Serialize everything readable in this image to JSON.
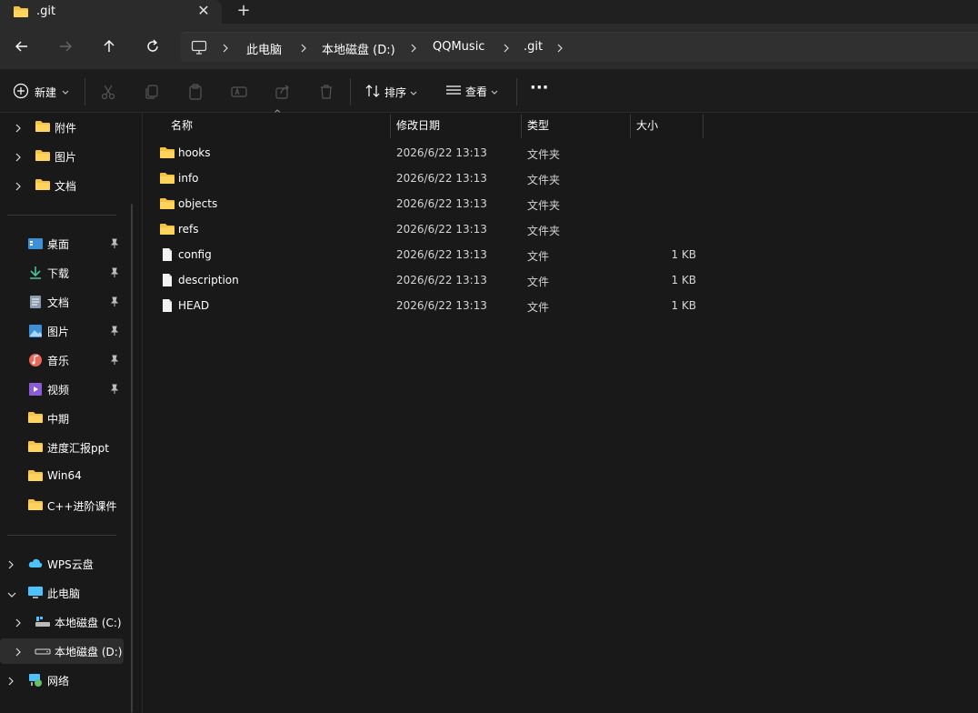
{
  "tab": {
    "title": ".git",
    "close": "✕",
    "new": "+"
  },
  "nav": {
    "back": "back-arrow-icon",
    "forward": "forward-arrow-icon",
    "up": "up-arrow-icon",
    "refresh": "refresh-icon"
  },
  "breadcrumb": [
    "此电脑",
    "本地磁盘 (D:)",
    "QQMusic",
    ".git"
  ],
  "toolbar": {
    "new_label": "新建",
    "sort_label": "排序",
    "view_label": "查看",
    "more_label": "···"
  },
  "sidebar": {
    "top_items": [
      "附件",
      "图片",
      "文档"
    ],
    "quick_access": [
      {
        "label": "桌面",
        "icon": "desktop-icon",
        "pinned": true
      },
      {
        "label": "下载",
        "icon": "download-icon",
        "pinned": true
      },
      {
        "label": "文档",
        "icon": "document-icon",
        "pinned": true
      },
      {
        "label": "图片",
        "icon": "picture-icon",
        "pinned": true
      },
      {
        "label": "音乐",
        "icon": "music-icon",
        "pinned": true
      },
      {
        "label": "视频",
        "icon": "video-icon",
        "pinned": true
      },
      {
        "label": "中期",
        "icon": "folder-icon",
        "pinned": false
      },
      {
        "label": "进度汇报ppt",
        "icon": "folder-icon",
        "pinned": false
      },
      {
        "label": "Win64",
        "icon": "folder-icon",
        "pinned": false
      },
      {
        "label": "C++进阶课件",
        "icon": "folder-icon",
        "pinned": false
      }
    ],
    "tree": [
      {
        "label": "WPS云盘",
        "icon": "cloud-icon"
      },
      {
        "label": "此电脑",
        "icon": "computer-icon"
      },
      {
        "label": "本地磁盘 (C:)",
        "icon": "drive-c-icon"
      },
      {
        "label": "本地磁盘 (D:)",
        "icon": "drive-d-icon"
      },
      {
        "label": "网络",
        "icon": "network-icon"
      }
    ]
  },
  "columns": {
    "name": "名称",
    "modified": "修改日期",
    "type": "类型",
    "size": "大小"
  },
  "files": [
    {
      "name": "hooks",
      "modified": "2026/6/22 13:13",
      "type": "文件夹",
      "size": ""
    },
    {
      "name": "info",
      "modified": "2026/6/22 13:13",
      "type": "文件夹",
      "size": ""
    },
    {
      "name": "objects",
      "modified": "2026/6/22 13:13",
      "type": "文件夹",
      "size": ""
    },
    {
      "name": "refs",
      "modified": "2026/6/22 13:13",
      "type": "文件夹",
      "size": ""
    },
    {
      "name": "config",
      "modified": "2026/6/22 13:13",
      "type": "文件",
      "size": "1 KB"
    },
    {
      "name": "description",
      "modified": "2026/6/22 13:13",
      "type": "文件",
      "size": "1 KB"
    },
    {
      "name": "HEAD",
      "modified": "2026/6/22 13:13",
      "type": "文件",
      "size": "1 KB"
    }
  ],
  "colors": {
    "folder": "#f5c242",
    "accent": "#4cc2ff"
  }
}
